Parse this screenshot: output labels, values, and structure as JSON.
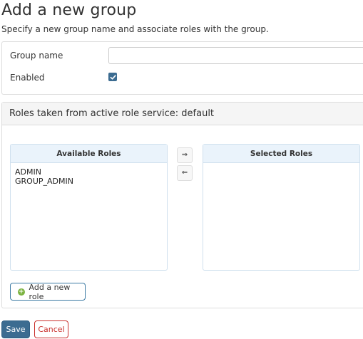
{
  "page": {
    "title": "Add a new group",
    "subtitle": "Specify a new group name and associate roles with the group."
  },
  "form": {
    "group_name_label": "Group name",
    "group_name_value": "",
    "enabled_label": "Enabled",
    "enabled_checked": true
  },
  "roles": {
    "header": "Roles taken from active role service: default",
    "available_title": "Available Roles",
    "selected_title": "Selected Roles",
    "available_items": [
      "ADMIN",
      "GROUP_ADMIN"
    ],
    "selected_items": [],
    "move_right_icon": "⇒",
    "move_left_icon": "⇐",
    "add_role_label": "Add a new role"
  },
  "actions": {
    "save_label": "Save",
    "cancel_label": "Cancel"
  },
  "colors": {
    "primary": "#3c6c91",
    "danger": "#c9302c",
    "success": "#7cb342"
  }
}
